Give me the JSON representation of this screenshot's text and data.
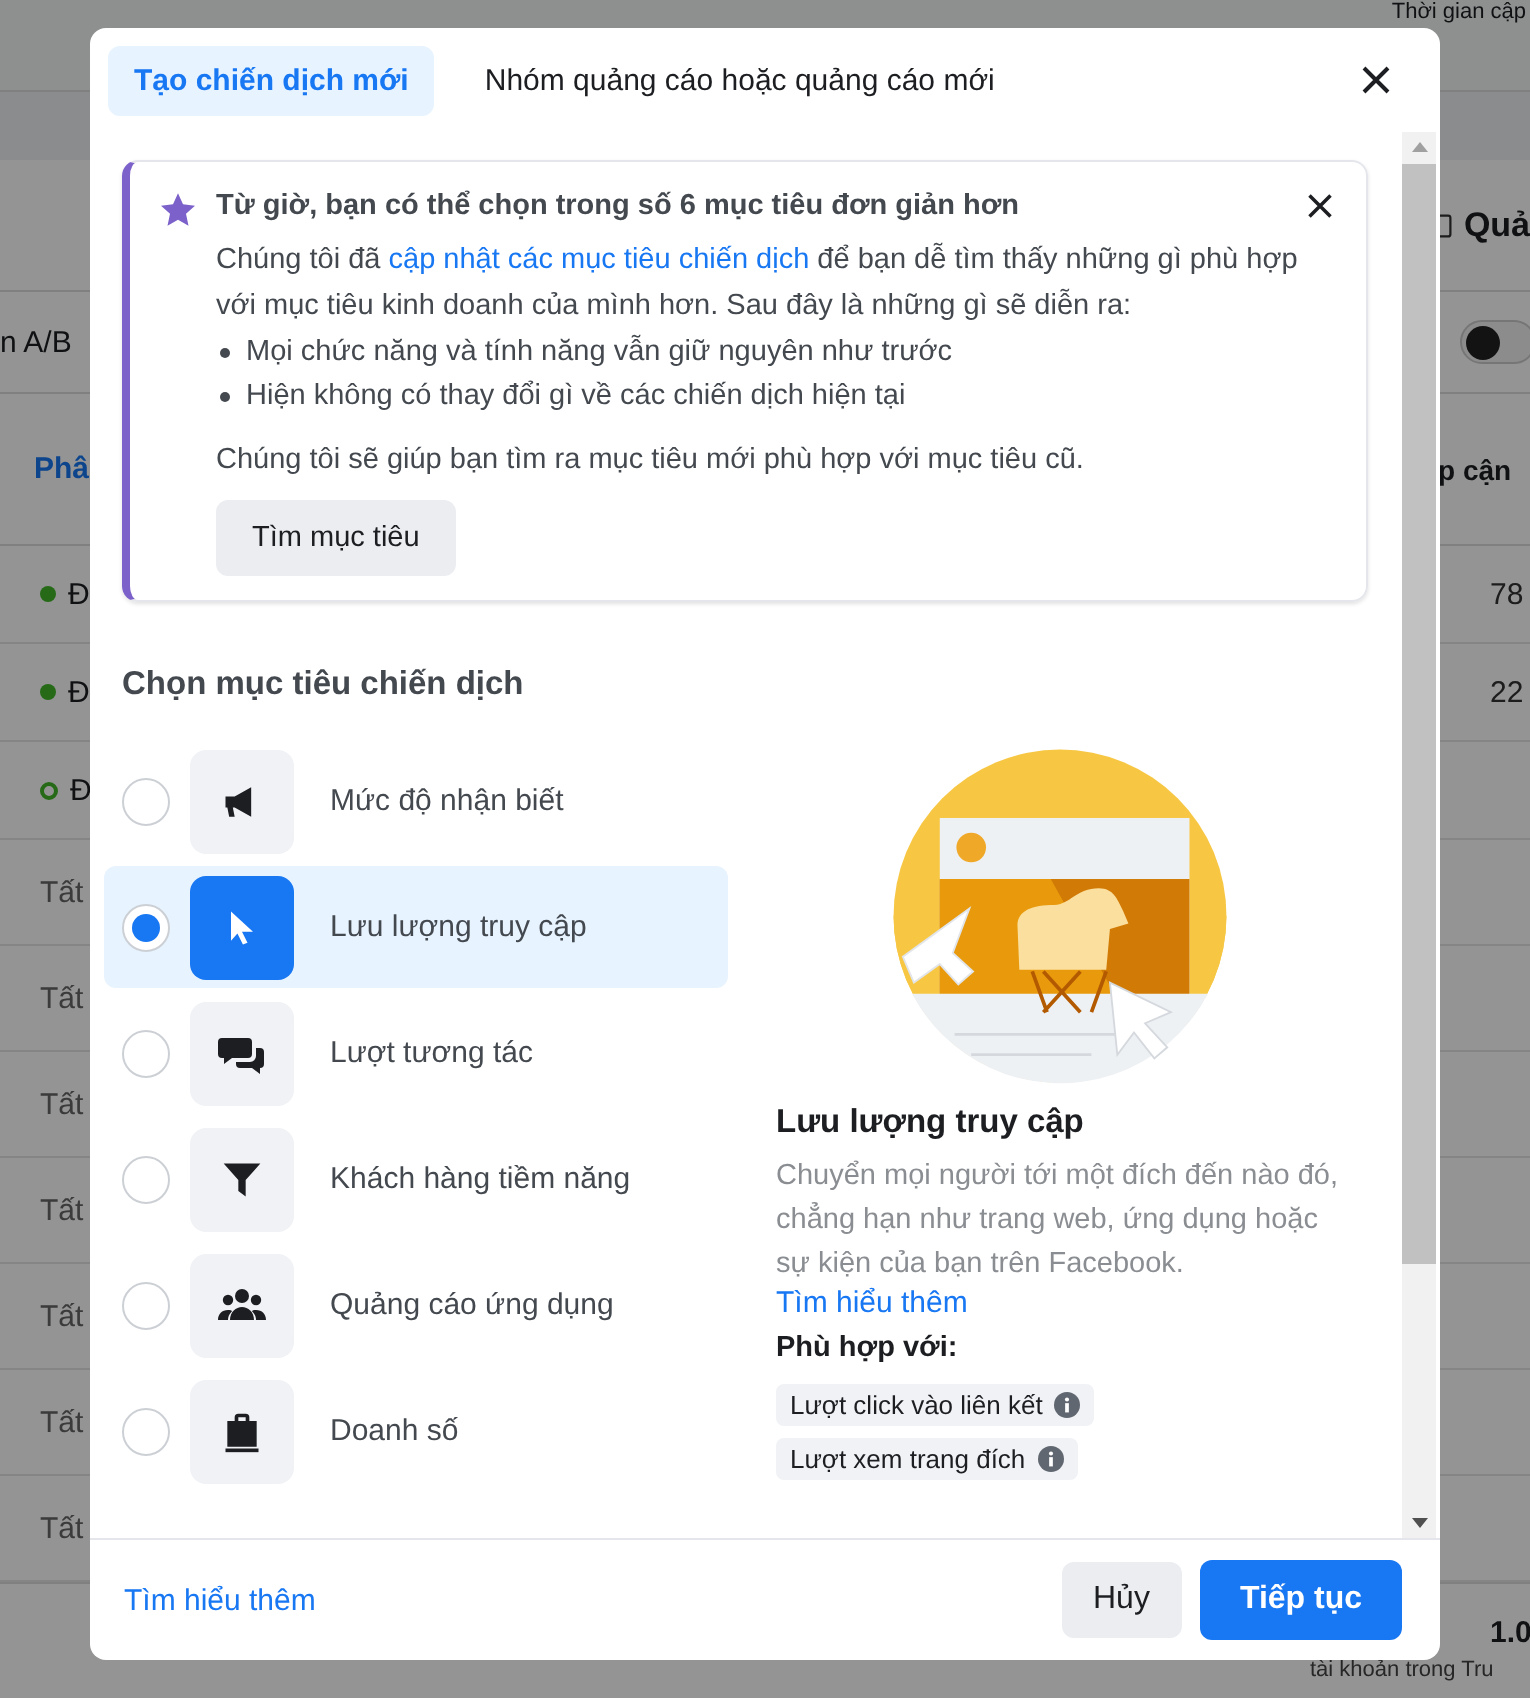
{
  "background": {
    "top_right_text": "Thời gian cập",
    "view_button": "Quả",
    "ab_label": "n A/B",
    "toggle": {
      "on": false
    },
    "columns": [
      "Phâ",
      "p cận"
    ],
    "rows": [
      {
        "kind": "dot",
        "status": "Đ",
        "value": "78"
      },
      {
        "kind": "dot",
        "status": "Đ",
        "value": "22"
      },
      {
        "kind": "ring",
        "status": "Đ"
      },
      {
        "kind": "plain",
        "status": "Tất"
      },
      {
        "kind": "plain",
        "status": "Tất"
      },
      {
        "kind": "plain",
        "status": "Tất"
      },
      {
        "kind": "plain",
        "status": "Tất"
      },
      {
        "kind": "plain",
        "status": "Tất"
      },
      {
        "kind": "plain",
        "status": "Tất"
      },
      {
        "kind": "plain",
        "status": "Tất"
      }
    ],
    "total": "1.0",
    "total_note": "tài khoản trong Tru"
  },
  "tabs": [
    {
      "label": "Tạo chiến dịch mới",
      "selected": true
    },
    {
      "label": "Nhóm quảng cáo hoặc quảng cáo mới",
      "selected": false
    }
  ],
  "notice": {
    "title": "Từ giờ, bạn có thể chọn trong số 6 mục tiêu đơn giản hơn",
    "text_before": "Chúng tôi đã ",
    "link": "cập nhật các mục tiêu chiến dịch",
    "text_after": " để bạn dễ tìm thấy những gì phù hợp với mục tiêu kinh doanh của mình hơn. Sau đây là những gì sẽ diễn ra:",
    "bullets": [
      "Mọi chức năng và tính năng vẫn giữ nguyên như trước",
      "Hiện không có thay đổi gì về các chiến dịch hiện tại"
    ],
    "closing": "Chúng tôi sẽ giúp bạn tìm ra mục tiêu mới phù hợp với mục tiêu cũ.",
    "button": "Tìm mục tiêu"
  },
  "section_title": "Chọn mục tiêu chiến dịch",
  "objectives": [
    {
      "label": "Mức độ nhận biết",
      "selected": false
    },
    {
      "label": "Lưu lượng truy cập",
      "selected": true
    },
    {
      "label": "Lượt tương tác",
      "selected": false
    },
    {
      "label": "Khách hàng tiềm năng",
      "selected": false
    },
    {
      "label": "Quảng cáo ứng dụng",
      "selected": false
    },
    {
      "label": "Doanh số",
      "selected": false
    }
  ],
  "detail": {
    "title": "Lưu lượng truy cập",
    "description": "Chuyển mọi người tới một đích đến nào đó, chẳng hạn như trang web, ứng dụng hoặc sự kiện của bạn trên Facebook.",
    "learn_more": "Tìm hiểu thêm",
    "fits_label": "Phù hợp với:",
    "tags": [
      "Lượt click vào liên kết",
      "Lượt xem trang đích"
    ]
  },
  "footer": {
    "learn_more": "Tìm hiểu thêm",
    "cancel": "Hủy",
    "continue": "Tiếp tục"
  }
}
